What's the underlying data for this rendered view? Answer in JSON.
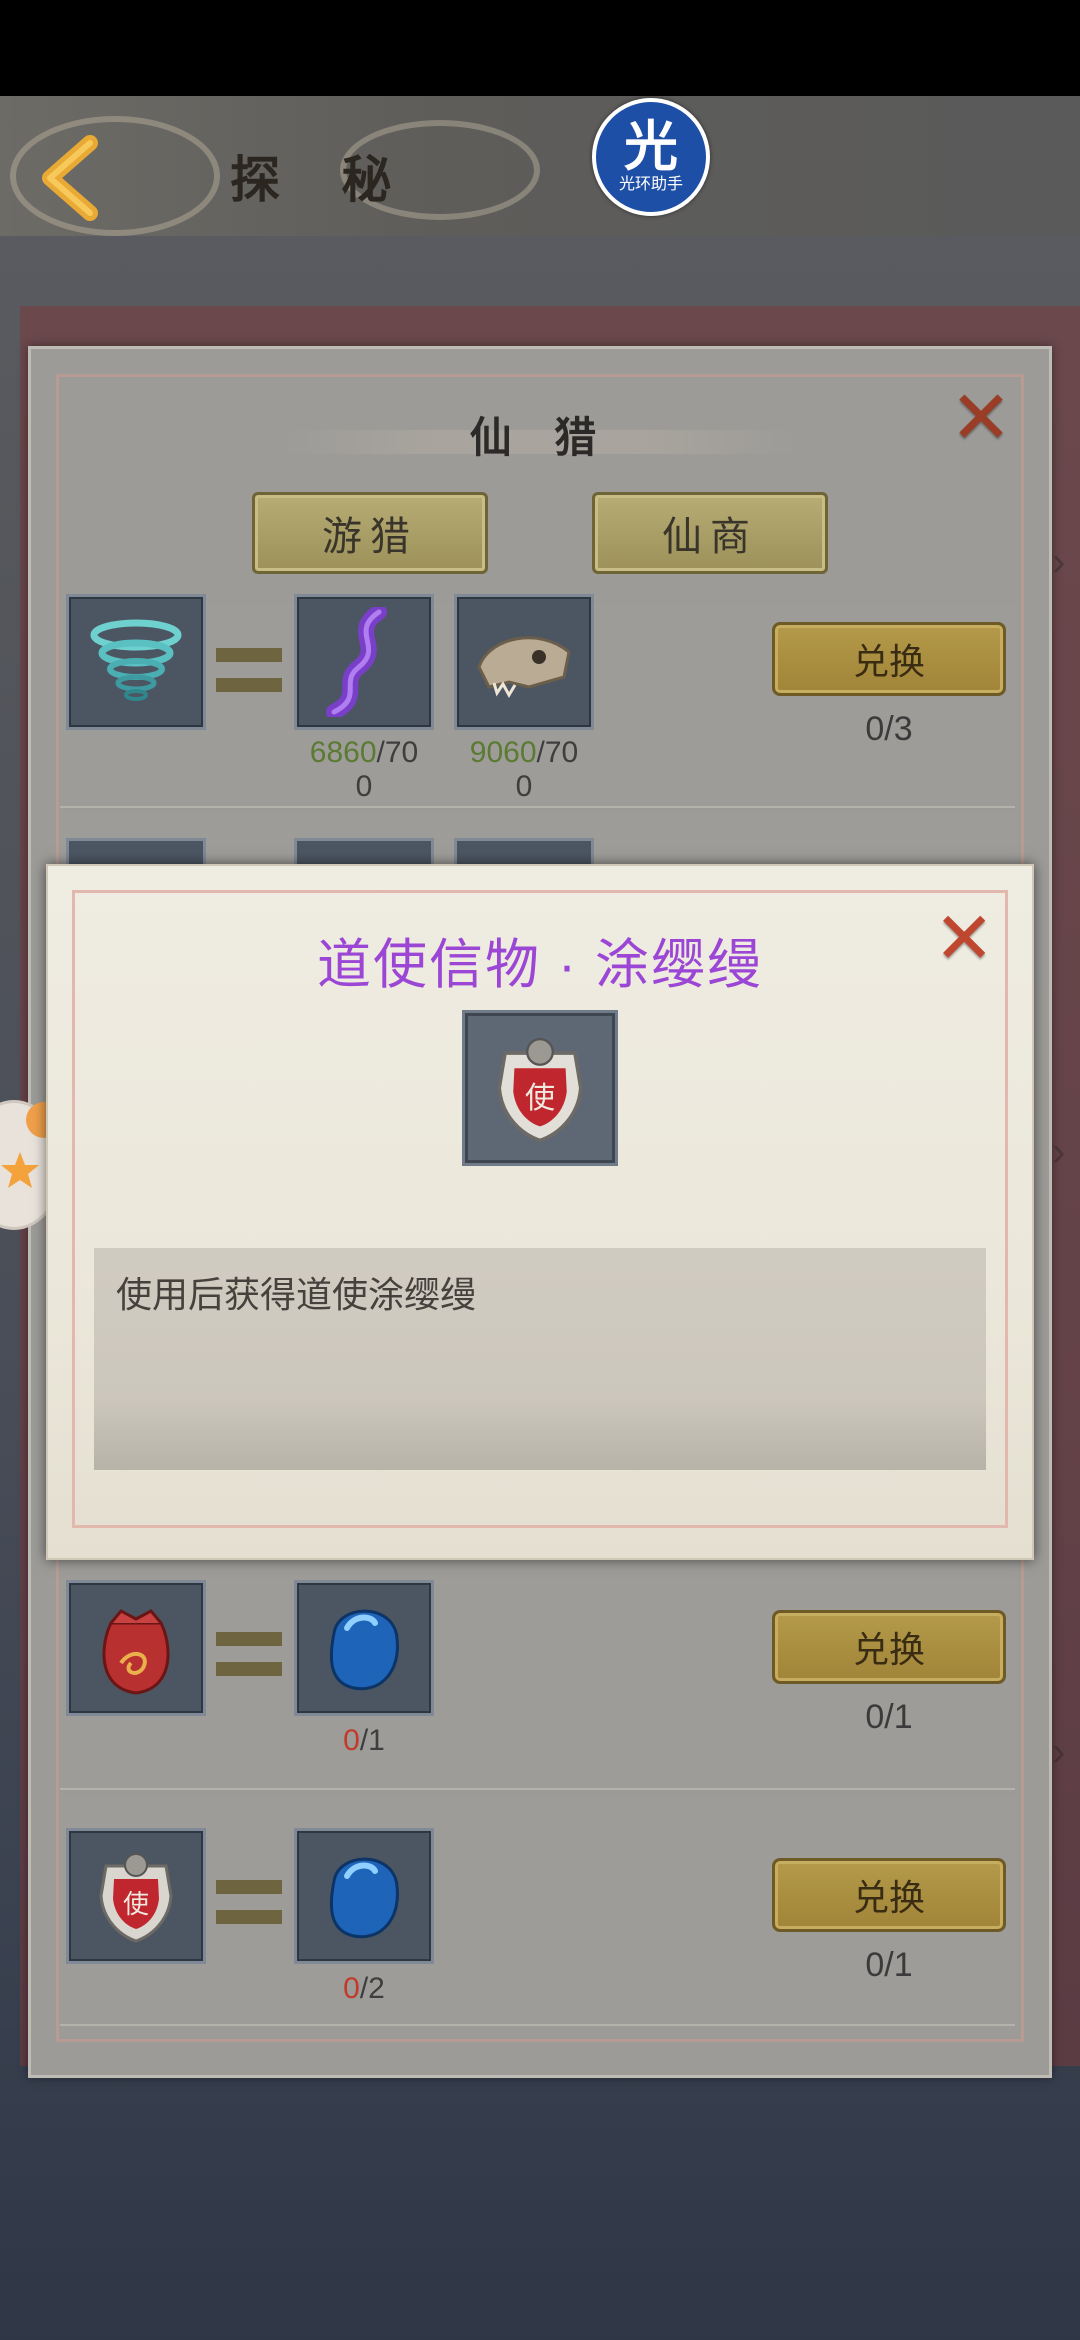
{
  "header": {
    "page_title": "探 秘",
    "helper_logo": {
      "big": "光",
      "small": "光环助手"
    }
  },
  "panel": {
    "title": "仙 猎",
    "tabs": [
      {
        "label": "游猎"
      },
      {
        "label": "仙商"
      }
    ]
  },
  "rows": [
    {
      "result_icon": "whirlwind-icon",
      "materials": [
        {
          "icon": "purple-feather-icon",
          "current": "6860",
          "total_line1": "/70",
          "total_line2": "0"
        },
        {
          "icon": "beast-skull-icon",
          "current": "9060",
          "total_line1": "/70",
          "total_line2": "0"
        }
      ],
      "button": "兑换",
      "count": "0/3"
    },
    {
      "result_icon": "red-pouch-icon",
      "materials": [
        {
          "icon": "blue-gem-icon",
          "current": "0",
          "total": "/1"
        }
      ],
      "button": "兑换",
      "count": "0/1"
    },
    {
      "result_icon": "envoy-token-icon",
      "materials": [
        {
          "icon": "blue-gem-icon",
          "current": "0",
          "total": "/2"
        }
      ],
      "button": "兑换",
      "count": "0/1"
    }
  ],
  "tooltip": {
    "title": "道使信物 · 涂缨缦",
    "icon": "envoy-token-icon",
    "description": "使用后获得道使涂缨缦"
  },
  "colors": {
    "tooltip_title": "#9b46d4",
    "have_ok": "#5b7a32",
    "have_insufficient": "#c23a2a",
    "close_x": "#9a3d27"
  }
}
